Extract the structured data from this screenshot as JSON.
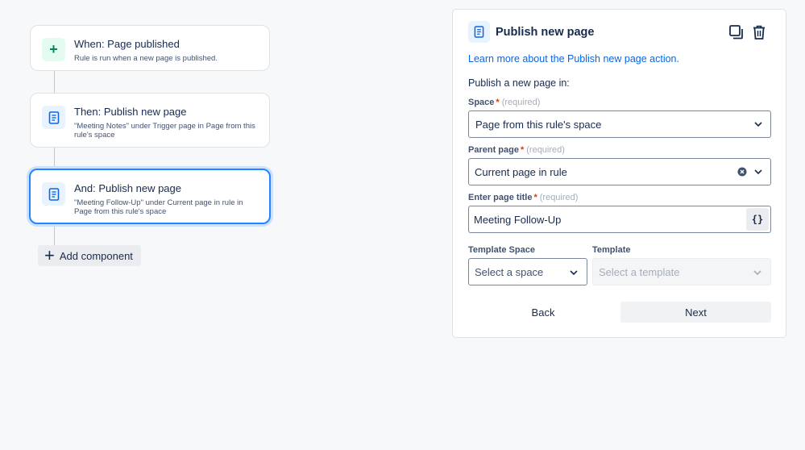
{
  "rule_flow": {
    "trigger": {
      "icon": "plus-icon",
      "title": "When: Page published",
      "description": "Rule is run when a new page is published."
    },
    "actions": [
      {
        "icon": "page-icon",
        "title": "Then: Publish new page",
        "description": "\"Meeting Notes\" under Trigger page in Page from this rule's space"
      },
      {
        "icon": "page-icon",
        "title": "And: Publish new page",
        "description": "\"Meeting Follow-Up\" under Current page in rule in Page from this rule's space",
        "selected": true
      }
    ],
    "add_component_label": "Add component"
  },
  "panel": {
    "title": "Publish new page",
    "icons": [
      "page-icon",
      "duplicate-icon",
      "trash-icon"
    ],
    "learn_link": "Learn more about the Publish new page action.",
    "intro": "Publish a new page in:",
    "required_marker": "*",
    "required_hint": "(required)",
    "space": {
      "label": "Space",
      "value": "Page from this rule's space"
    },
    "parent_page": {
      "label": "Parent page",
      "value": "Current page in rule"
    },
    "page_title": {
      "label": "Enter page title",
      "value": "Meeting Follow-Up",
      "smart_value_button": "{}"
    },
    "template_space": {
      "label": "Template Space",
      "placeholder": "Select a space"
    },
    "template": {
      "label": "Template",
      "placeholder": "Select a template",
      "disabled": true
    },
    "back_label": "Back",
    "next_label": "Next"
  },
  "colors": {
    "accent_blue": "#2684ff",
    "link_blue": "#0c66e4",
    "required_red": "#de350b",
    "trigger_green": "#00875a"
  }
}
